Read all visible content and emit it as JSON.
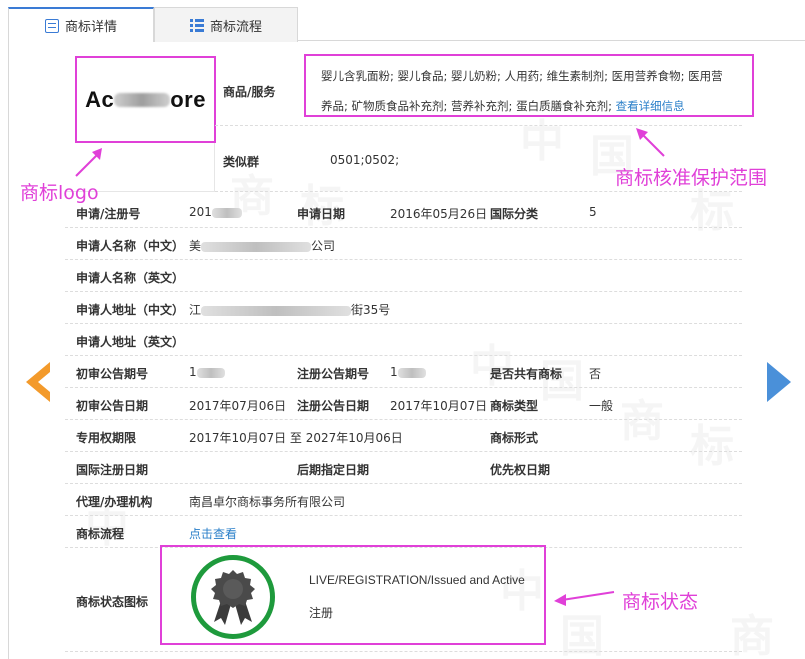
{
  "tabs": [
    {
      "label": "商标详情",
      "active": true
    },
    {
      "label": "商标流程",
      "active": false
    }
  ],
  "logo": {
    "text_start": "Ac",
    "text_end": "ore"
  },
  "goods": {
    "label": "商品/服务",
    "line1": "婴儿含乳面粉; 婴儿食品; 婴儿奶粉; 人用药; 维生素制剂; 医用营养食物; 医用营",
    "line2": "养品; 矿物质食品补充剂; 营养补充剂; 蛋白质膳食补充剂;",
    "more_link": "查看详细信息"
  },
  "similar_group": {
    "label": "类似群",
    "value": "0501;0502;"
  },
  "fields": {
    "reg_no_label": "申请/注册号",
    "reg_no_value": "201",
    "apply_date_label": "申请日期",
    "apply_date_value": "2016年05月26日",
    "intl_class_label": "国际分类",
    "intl_class_value": "5",
    "applicant_cn_label": "申请人名称（中文）",
    "applicant_cn_prefix": "美",
    "applicant_cn_suffix": "公司",
    "applicant_en_label": "申请人名称（英文）",
    "address_cn_label": "申请人地址（中文）",
    "address_cn_prefix": "江",
    "address_cn_suffix": "街35号",
    "address_en_label": "申请人地址（英文）",
    "prelim_no_label": "初审公告期号",
    "prelim_no_value": "1",
    "reg_pub_no_label": "注册公告期号",
    "reg_pub_no_value": "1",
    "shared_label": "是否共有商标",
    "shared_value": "否",
    "prelim_date_label": "初审公告日期",
    "prelim_date_value": "2017年07月06日",
    "reg_pub_date_label": "注册公告日期",
    "reg_pub_date_value": "2017年10月07日",
    "tm_type_label": "商标类型",
    "tm_type_value": "一般",
    "term_label": "专用权期限",
    "term_value": "2017年10月07日 至 2027年10月06日",
    "tm_form_label": "商标形式",
    "intl_reg_date_label": "国际注册日期",
    "later_date_label": "后期指定日期",
    "priority_date_label": "优先权日期",
    "agent_label": "代理/办理机构",
    "agent_value": "南昌卓尔商标事务所有限公司",
    "process_label": "商标流程",
    "process_link": "点击查看",
    "status_label": "商标状态图标",
    "status_en": "LIVE/REGISTRATION/Issued and Active",
    "status_cn": "注册"
  },
  "annotations": {
    "logo": "商标logo",
    "scope": "商标核准保护范围",
    "status": "商标状态"
  },
  "colors": {
    "annotation": "#e040d8",
    "accent": "#2a7fc9",
    "nav_left": "#f39a2b",
    "nav_right": "#4a90d9",
    "seal_ring": "#1e9a3c"
  }
}
